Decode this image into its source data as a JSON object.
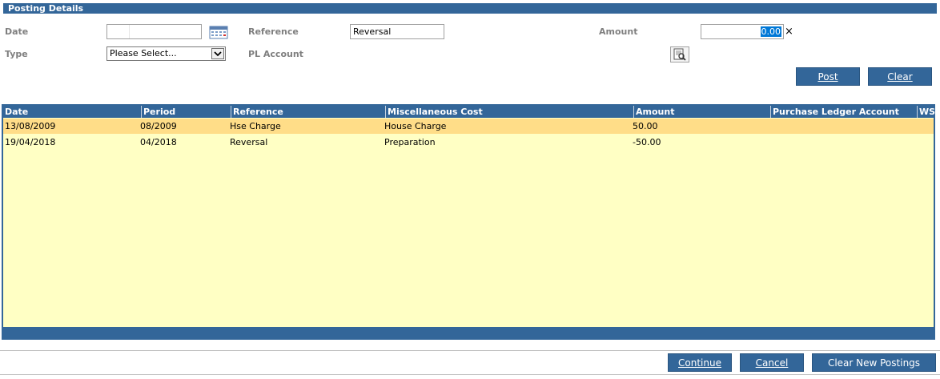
{
  "section": {
    "title": "Posting Details"
  },
  "form": {
    "date_label": "Date",
    "type_label": "Type",
    "type_selected": "Please Select...",
    "reference_label": "Reference",
    "reference_value": "Reversal",
    "pl_account_label": "PL Account",
    "amount_label": "Amount",
    "amount_value": "0.00",
    "clear_glyph": "×"
  },
  "actions": {
    "post_label": "Post",
    "clear_label": "Clear"
  },
  "grid": {
    "columns": [
      "Date",
      "Period",
      "Reference",
      "Miscellaneous Cost",
      "Amount",
      "Purchase Ledger Account",
      "WS"
    ],
    "rows": [
      {
        "date": "13/08/2009",
        "period": "08/2009",
        "reference": "Hse Charge",
        "misc_cost": "House Charge",
        "amount": "50.00",
        "pl_account": "",
        "ws": ""
      },
      {
        "date": "19/04/2018",
        "period": "04/2018",
        "reference": "Reversal",
        "misc_cost": "Preparation",
        "amount": "-50.00",
        "pl_account": "",
        "ws": ""
      }
    ]
  },
  "footer": {
    "continue_label": "Continue",
    "cancel_label": "Cancel",
    "clear_new_postings_label": "Clear New Postings"
  },
  "icons": {
    "calendar": "calendar-icon",
    "lookup": "lookup-icon",
    "dropdown": "chevron-down-icon"
  },
  "colors": {
    "header_blue": "#336699",
    "grid_background": "#ffffc4",
    "selected_row": "#ffdd88",
    "label_gray": "#7f7f7f"
  }
}
